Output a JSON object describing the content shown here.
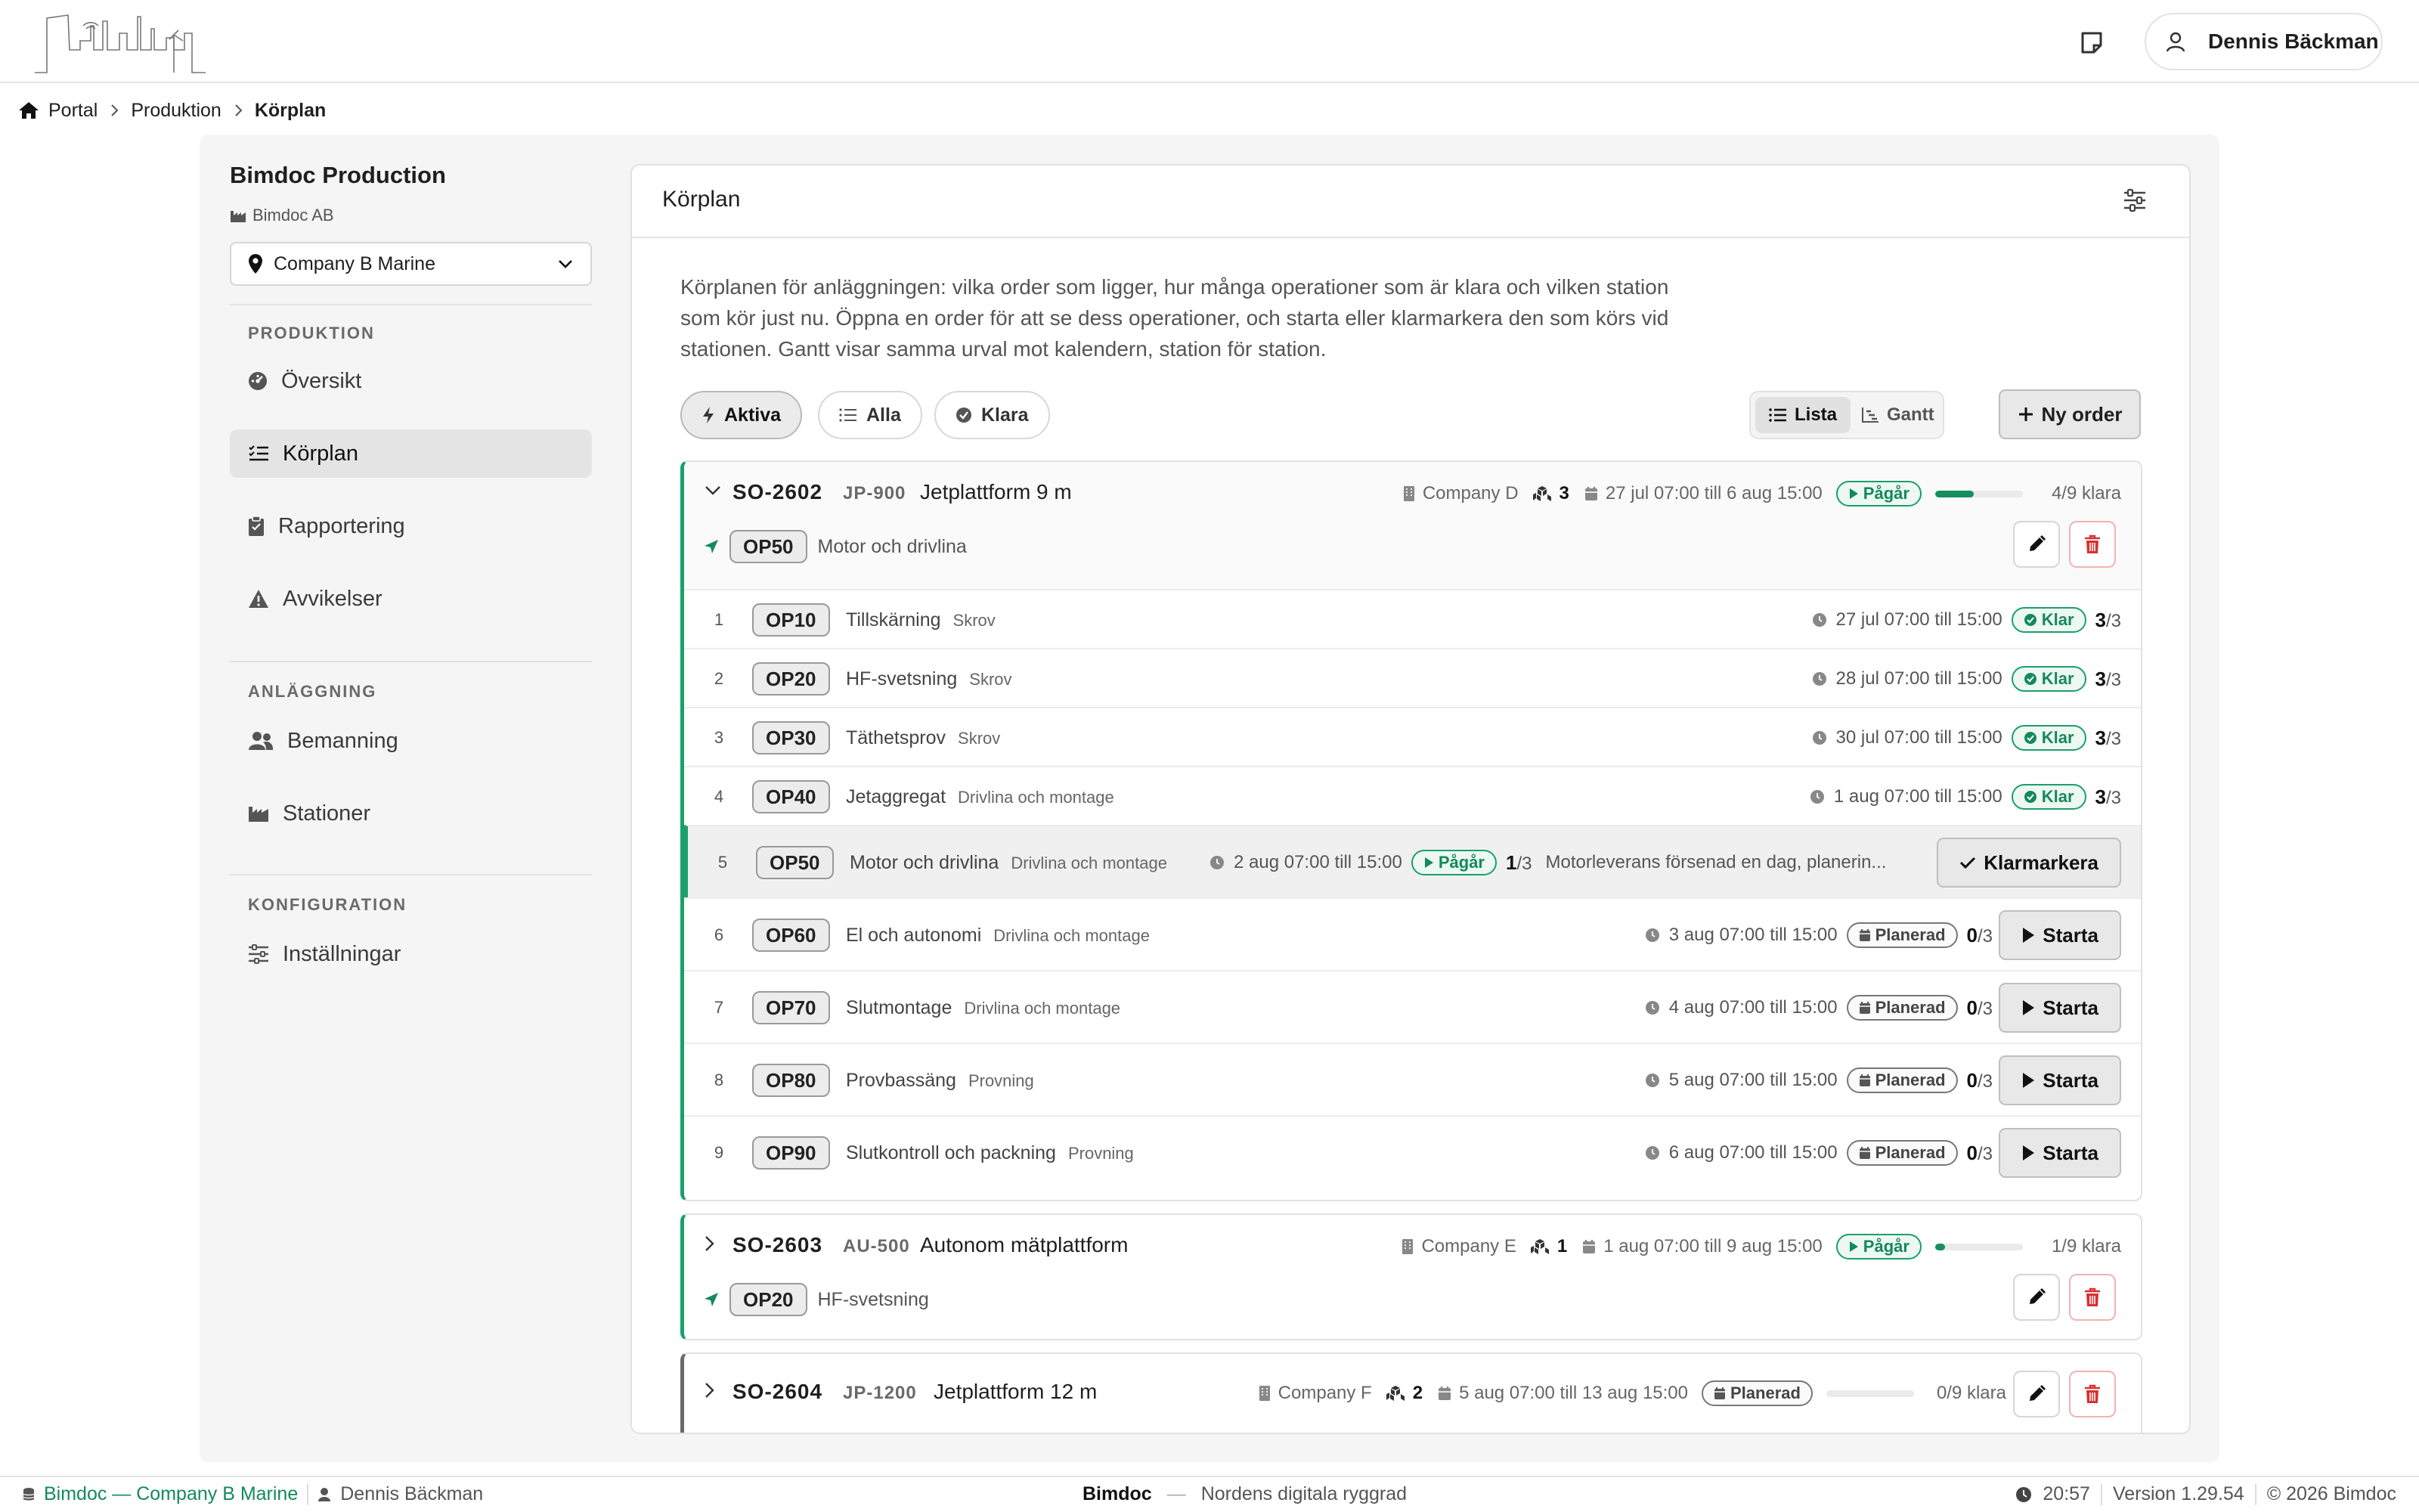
{
  "header": {
    "user_name": "Dennis Bäckman"
  },
  "breadcrumb": [
    "Portal",
    "Produktion",
    "Körplan"
  ],
  "sidebar": {
    "title": "Bimdoc Production",
    "company": "Bimdoc AB",
    "site_select": "Company B Marine",
    "sections": [
      {
        "label": "PRODUKTION",
        "items": [
          {
            "label": "Översikt",
            "icon": "gauge-icon"
          },
          {
            "label": "Körplan",
            "icon": "list-check-icon",
            "active": true
          },
          {
            "label": "Rapportering",
            "icon": "clipboard-icon"
          },
          {
            "label": "Avvikelser",
            "icon": "warning-icon"
          }
        ]
      },
      {
        "label": "ANLÄGGNING",
        "items": [
          {
            "label": "Bemanning",
            "icon": "users-icon"
          },
          {
            "label": "Stationer",
            "icon": "industry-icon"
          }
        ]
      },
      {
        "label": "KONFIGURATION",
        "items": [
          {
            "label": "Inställningar",
            "icon": "sliders-icon"
          }
        ]
      }
    ]
  },
  "card": {
    "title": "Körplan",
    "description": "Körplanen för anläggningen: vilka order som ligger, hur många operationer som är klara och vilken station som kör just nu. Öppna en order för att se dess operationer, och starta eller klarmarkera den som körs vid stationen. Gantt visar samma urval mot kalendern, station för station.",
    "filters": [
      {
        "label": "Aktiva",
        "active": true
      },
      {
        "label": "Alla"
      },
      {
        "label": "Klara"
      }
    ],
    "views": [
      {
        "label": "Lista",
        "active": true
      },
      {
        "label": "Gantt"
      }
    ],
    "new_order": "Ny order"
  },
  "orders": [
    {
      "id": "SO-2602",
      "code": "JP-900",
      "name": "Jetplattform 9 m",
      "customer": "Company D",
      "qty": "3",
      "dates": "27 jul 07:00 till 6 aug 15:00",
      "status": "Pågår",
      "progress": 0.44,
      "progress_text": "4/9 klara",
      "current_op_code": "OP50",
      "current_op_name": "Motor och drivlina",
      "ops": [
        {
          "n": "1",
          "code": "OP10",
          "name": "Tillskärning",
          "station": "Skrov",
          "dates": "27 jul 07:00 till 15:00",
          "status": "Klar",
          "done": "3",
          "total": "/3"
        },
        {
          "n": "2",
          "code": "OP20",
          "name": "HF-svetsning",
          "station": "Skrov",
          "dates": "28 jul 07:00 till 15:00",
          "status": "Klar",
          "done": "3",
          "total": "/3"
        },
        {
          "n": "3",
          "code": "OP30",
          "name": "Täthetsprov",
          "station": "Skrov",
          "dates": "30 jul 07:00 till 15:00",
          "status": "Klar",
          "done": "3",
          "total": "/3"
        },
        {
          "n": "4",
          "code": "OP40",
          "name": "Jetaggregat",
          "station": "Drivlina och montage",
          "dates": "1 aug 07:00 till 15:00",
          "status": "Klar",
          "done": "3",
          "total": "/3"
        },
        {
          "n": "5",
          "code": "OP50",
          "name": "Motor och drivlina",
          "station": "Drivlina och montage",
          "dates": "2 aug 07:00 till 15:00",
          "status": "Pågår",
          "done": "1",
          "total": "/3",
          "note": "Motorleverans försenad en dag, planerin...",
          "action": "Klarmarkera"
        },
        {
          "n": "6",
          "code": "OP60",
          "name": "El och autonomi",
          "station": "Drivlina och montage",
          "dates": "3 aug 07:00 till 15:00",
          "status": "Planerad",
          "done": "0",
          "total": "/3",
          "action": "Starta"
        },
        {
          "n": "7",
          "code": "OP70",
          "name": "Slutmontage",
          "station": "Drivlina och montage",
          "dates": "4 aug 07:00 till 15:00",
          "status": "Planerad",
          "done": "0",
          "total": "/3",
          "action": "Starta"
        },
        {
          "n": "8",
          "code": "OP80",
          "name": "Provbassäng",
          "station": "Provning",
          "dates": "5 aug 07:00 till 15:00",
          "status": "Planerad",
          "done": "0",
          "total": "/3",
          "action": "Starta"
        },
        {
          "n": "9",
          "code": "OP90",
          "name": "Slutkontroll och packning",
          "station": "Provning",
          "dates": "6 aug 07:00 till 15:00",
          "status": "Planerad",
          "done": "0",
          "total": "/3",
          "action": "Starta"
        }
      ]
    },
    {
      "id": "SO-2603",
      "code": "AU-500",
      "name": "Autonom mätplattform",
      "customer": "Company E",
      "qty": "1",
      "dates": "1 aug 07:00 till 9 aug 15:00",
      "status": "Pågår",
      "progress": 0.11,
      "progress_text": "1/9 klara",
      "current_op_code": "OP20",
      "current_op_name": "HF-svetsning"
    },
    {
      "id": "SO-2604",
      "code": "JP-1200",
      "name": "Jetplattform 12 m",
      "customer": "Company F",
      "qty": "2",
      "dates": "5 aug 07:00 till 13 aug 15:00",
      "status": "Planerad",
      "progress": 0,
      "progress_text": "0/9 klara"
    }
  ],
  "footer": {
    "site": "Bimdoc — Company B Marine",
    "user": "Dennis Bäckman",
    "brand": "Bimdoc",
    "dash": "—",
    "tagline": "Nordens digitala ryggrad",
    "time": "20:57",
    "version": "Version 1.29.54",
    "copyright": "© 2026 Bimdoc"
  },
  "colors": {
    "accent_green": "#1aa06a",
    "delete_red": "#d93030",
    "planned_gray": "#6a6a6a"
  }
}
